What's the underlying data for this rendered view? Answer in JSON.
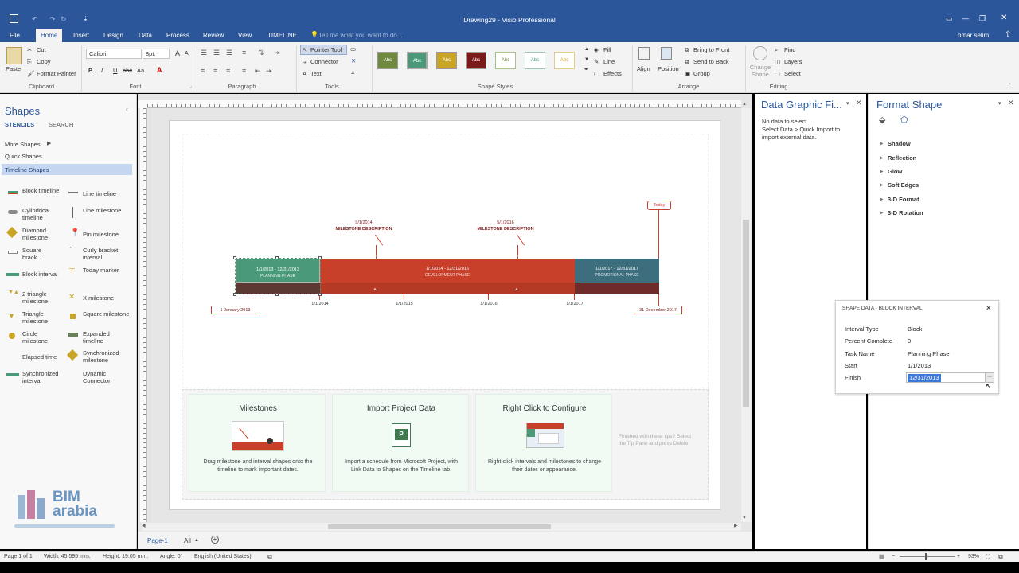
{
  "window": {
    "title": "Drawing29 - Visio Professional",
    "user": "omar selim"
  },
  "tabs": [
    "File",
    "Home",
    "Insert",
    "Design",
    "Data",
    "Process",
    "Review",
    "View",
    "TIMELINE"
  ],
  "tell_me": "Tell me what you want to do...",
  "clipboard": {
    "paste": "Paste",
    "cut": "Cut",
    "copy": "Copy",
    "format_painter": "Format Painter",
    "label": "Clipboard"
  },
  "font": {
    "name": "Calibri",
    "size": "8pt.",
    "label": "Font",
    "bold": "B",
    "italic": "I",
    "underline": "U",
    "strike": "abc",
    "size_up": "A",
    "size_down": "A",
    "aa": "Aa",
    "color": "A"
  },
  "paragraph": {
    "label": "Paragraph"
  },
  "tools": {
    "pointer": "Pointer Tool",
    "connector": "Connector",
    "text": "Text",
    "label": "Tools"
  },
  "shape_styles": {
    "label": "Shape Styles",
    "swatch_text": "Abc",
    "fill": "Fill",
    "line": "Line",
    "effects": "Effects"
  },
  "arrange": {
    "align": "Align",
    "position": "Position",
    "bring_front": "Bring to Front",
    "send_back": "Send to Back",
    "group": "Group",
    "label": "Arrange"
  },
  "editing": {
    "change_shape": "Change Shape",
    "find": "Find",
    "layers": "Layers",
    "select": "Select",
    "label": "Editing"
  },
  "shapes_pane": {
    "title": "Shapes",
    "stencils": "STENCILS",
    "search": "SEARCH",
    "more_shapes": "More Shapes",
    "quick_shapes": "Quick Shapes",
    "timeline_shapes": "Timeline Shapes",
    "items": [
      [
        "Block timeline",
        "Line timeline"
      ],
      [
        "Cylindrical timeline",
        "Line milestone"
      ],
      [
        "Diamond milestone",
        "Pin milestone"
      ],
      [
        "Square brack...",
        "Curly bracket interval"
      ],
      [
        "Block interval",
        "Today marker"
      ],
      [
        "2 triangle milestone",
        "X milestone"
      ],
      [
        "Triangle milestone",
        "Square milestone"
      ],
      [
        "Circle milestone",
        "Expanded timeline"
      ],
      [
        "Elapsed time",
        "Synchronized milestone"
      ],
      [
        "Synchronized interval",
        "Dynamic Connector"
      ]
    ]
  },
  "timeline": {
    "milestone1_date": "9/1/2014",
    "milestone1_desc": "MILESTONE DESCRIPTION",
    "milestone2_date": "5/1/2016",
    "milestone2_desc": "MILESTONE DESCRIPTION",
    "today": "Today",
    "phase1": "1/1/2013 - 12/31/2013",
    "phase1_name": "PLANNING PHASE",
    "phase2": "1/1/2014 - 12/31/2016",
    "phase2_name": "DEVELOPMENT PHASE",
    "phase3": "1/1/2017 - 12/31/2017",
    "phase3_name": "PROMOTIONAL PHASE",
    "start": "1 January 2013",
    "end": "31 December 2017",
    "ticks": [
      "1/1/2014",
      "1/1/2015",
      "1/1/2016",
      "1/1/2017"
    ]
  },
  "tips": [
    {
      "title": "Milestones",
      "text": "Drag milestone and interval shapes onto the timeline to mark important dates."
    },
    {
      "title": "Import Project Data",
      "text": "Import a schedule from Microsoft Project, with Link Data to Shapes on the Timeline tab."
    },
    {
      "title": "Right Click to Configure",
      "text": "Right-click intervals and milestones to change their dates or appearance."
    }
  ],
  "tips_finished": "Finished with these tips? Select the Tip Pane and press Delete",
  "data_graphic": {
    "title": "Data Graphic Fi...",
    "no_data": "No data to select.",
    "hint": "Select Data > Quick Import to import external data."
  },
  "format_shape": {
    "title": "Format Shape",
    "items": [
      "Shadow",
      "Reflection",
      "Glow",
      "Soft Edges",
      "3-D Format",
      "3-D Rotation"
    ]
  },
  "shape_data": {
    "title": "SHAPE DATA - BLOCK INTERVAL",
    "rows": [
      [
        "Interval Type",
        "Block"
      ],
      [
        "Percent Complete",
        "0"
      ],
      [
        "Task Name",
        "Planning Phase"
      ],
      [
        "Start",
        "1/1/2013"
      ],
      [
        "Finish",
        "12/31/2013"
      ]
    ]
  },
  "status": {
    "page": "Page 1 of 1",
    "width": "Width: 45.595 mm.",
    "height": "Height: 19.05 mm.",
    "angle": "Angle: 0°",
    "lang": "English (United States)",
    "zoom": "93%"
  },
  "page_tabs": {
    "page1": "Page-1",
    "all": "All"
  },
  "watermark": {
    "line1": "BIM",
    "line2": "arabia"
  },
  "colors": {
    "accent": "#2b579a",
    "green": "#4a9a7a",
    "orange": "#c9402a",
    "teal": "#3d6e7e"
  }
}
